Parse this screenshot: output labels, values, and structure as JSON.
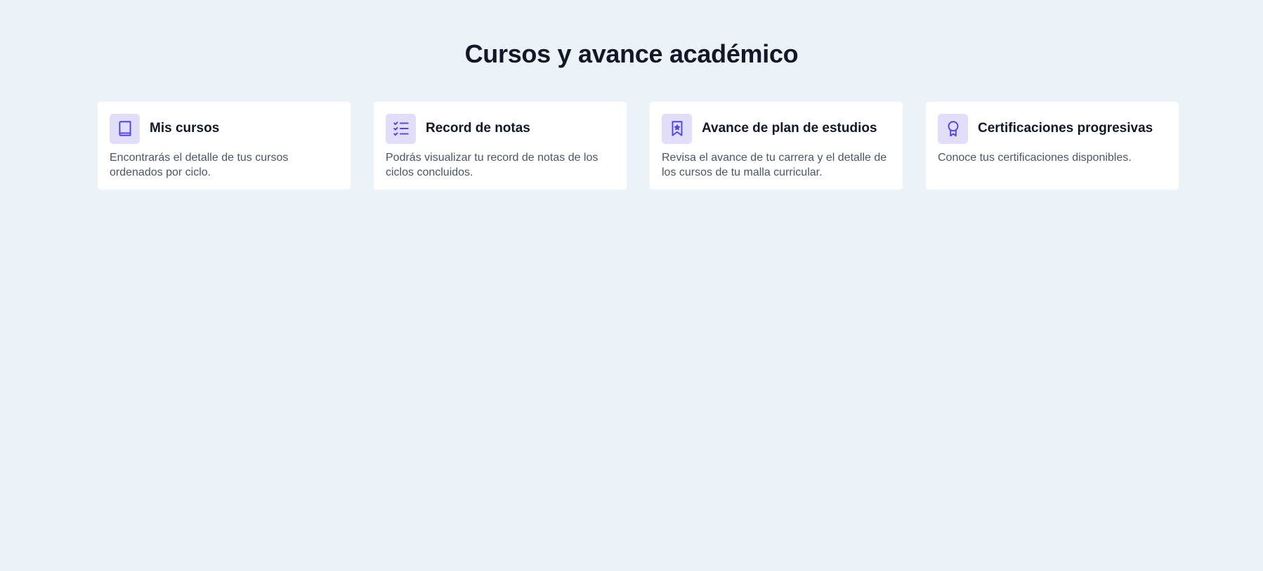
{
  "page": {
    "title": "Cursos y avance académico"
  },
  "colors": {
    "background": "#ebf2f8",
    "card": "#ffffff",
    "icon_bg": "#e2defa",
    "icon_accent": "#4f46e5",
    "title_text": "#111827",
    "body_text": "#4b5563"
  },
  "cards": [
    {
      "icon": "book-icon",
      "title": "Mis cursos",
      "description": "Encontrarás el detalle de tus cursos ordenados por ciclo."
    },
    {
      "icon": "checklist-icon",
      "title": "Record de notas",
      "description": "Podrás visualizar tu record de notas de los ciclos concluidos."
    },
    {
      "icon": "bookmark-star-icon",
      "title": "Avance de plan de estudios",
      "description": "Revisa el avance de tu carrera y el detalle de los cursos de tu malla curricular."
    },
    {
      "icon": "award-ribbon-icon",
      "title": "Certificaciones progresivas",
      "description": "Conoce tus certificaciones disponibles."
    }
  ]
}
